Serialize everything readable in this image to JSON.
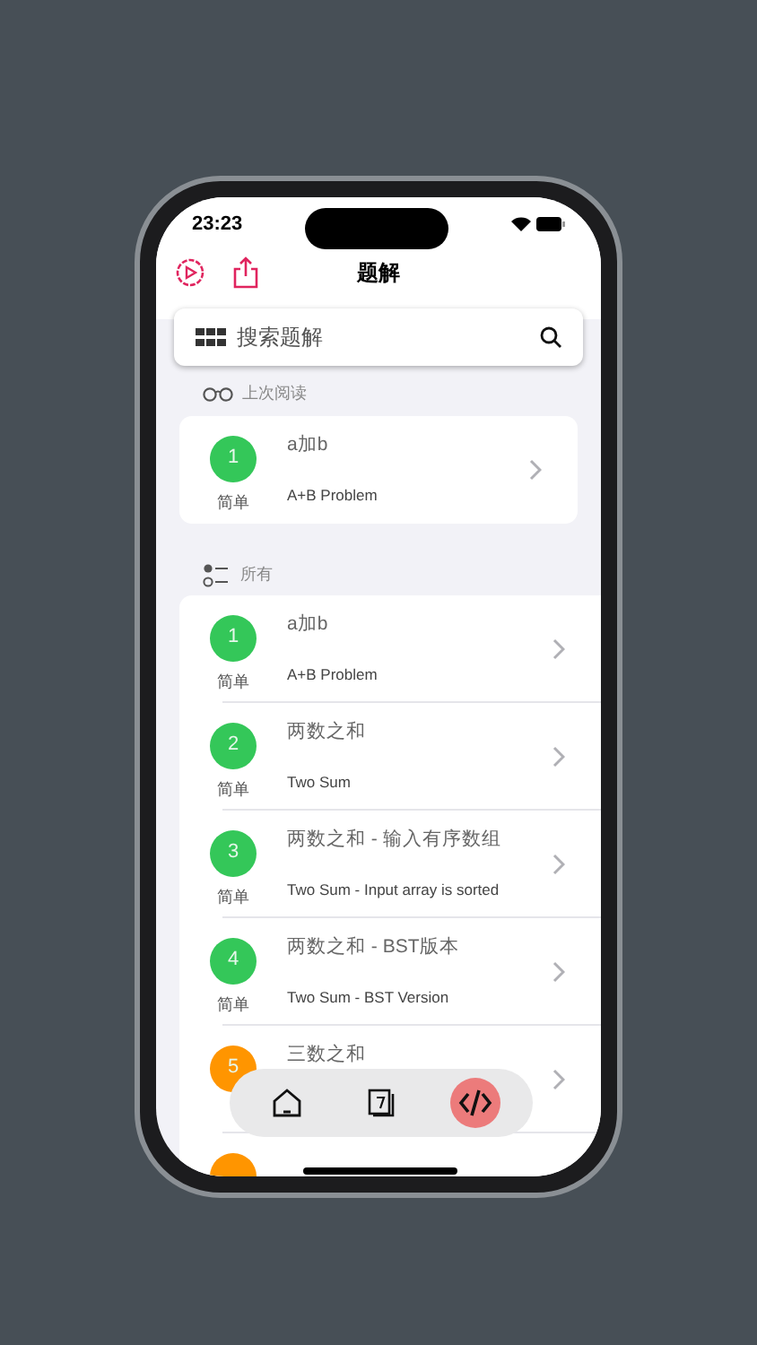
{
  "status_bar": {
    "time": "23:23"
  },
  "nav": {
    "title": "题解"
  },
  "search": {
    "placeholder": "搜索题解"
  },
  "recent": {
    "label": "上次阅读",
    "items": [
      {
        "number": "1",
        "color": "#34c759",
        "difficulty": "简单",
        "title": "a加b",
        "subtitle": "A+B Problem"
      }
    ]
  },
  "all": {
    "label": "所有",
    "items": [
      {
        "number": "1",
        "color": "#34c759",
        "difficulty": "简单",
        "title": "a加b",
        "subtitle": "A+B Problem"
      },
      {
        "number": "2",
        "color": "#34c759",
        "difficulty": "简单",
        "title": "两数之和",
        "subtitle": "Two Sum"
      },
      {
        "number": "3",
        "color": "#34c759",
        "difficulty": "简单",
        "title": "两数之和 - 输入有序数组",
        "subtitle": "Two Sum - Input array is sorted"
      },
      {
        "number": "4",
        "color": "#34c759",
        "difficulty": "简单",
        "title": "两数之和 - BST版本",
        "subtitle": "Two Sum - BST Version"
      },
      {
        "number": "5",
        "color": "#ff9500",
        "title": "三数之和"
      },
      {
        "color": "#ff9500"
      }
    ]
  },
  "tab_bar": {
    "tabs": [
      {
        "kind": "home",
        "selected": false
      },
      {
        "kind": "notes",
        "selected": false
      },
      {
        "kind": "code",
        "selected": true
      }
    ]
  }
}
